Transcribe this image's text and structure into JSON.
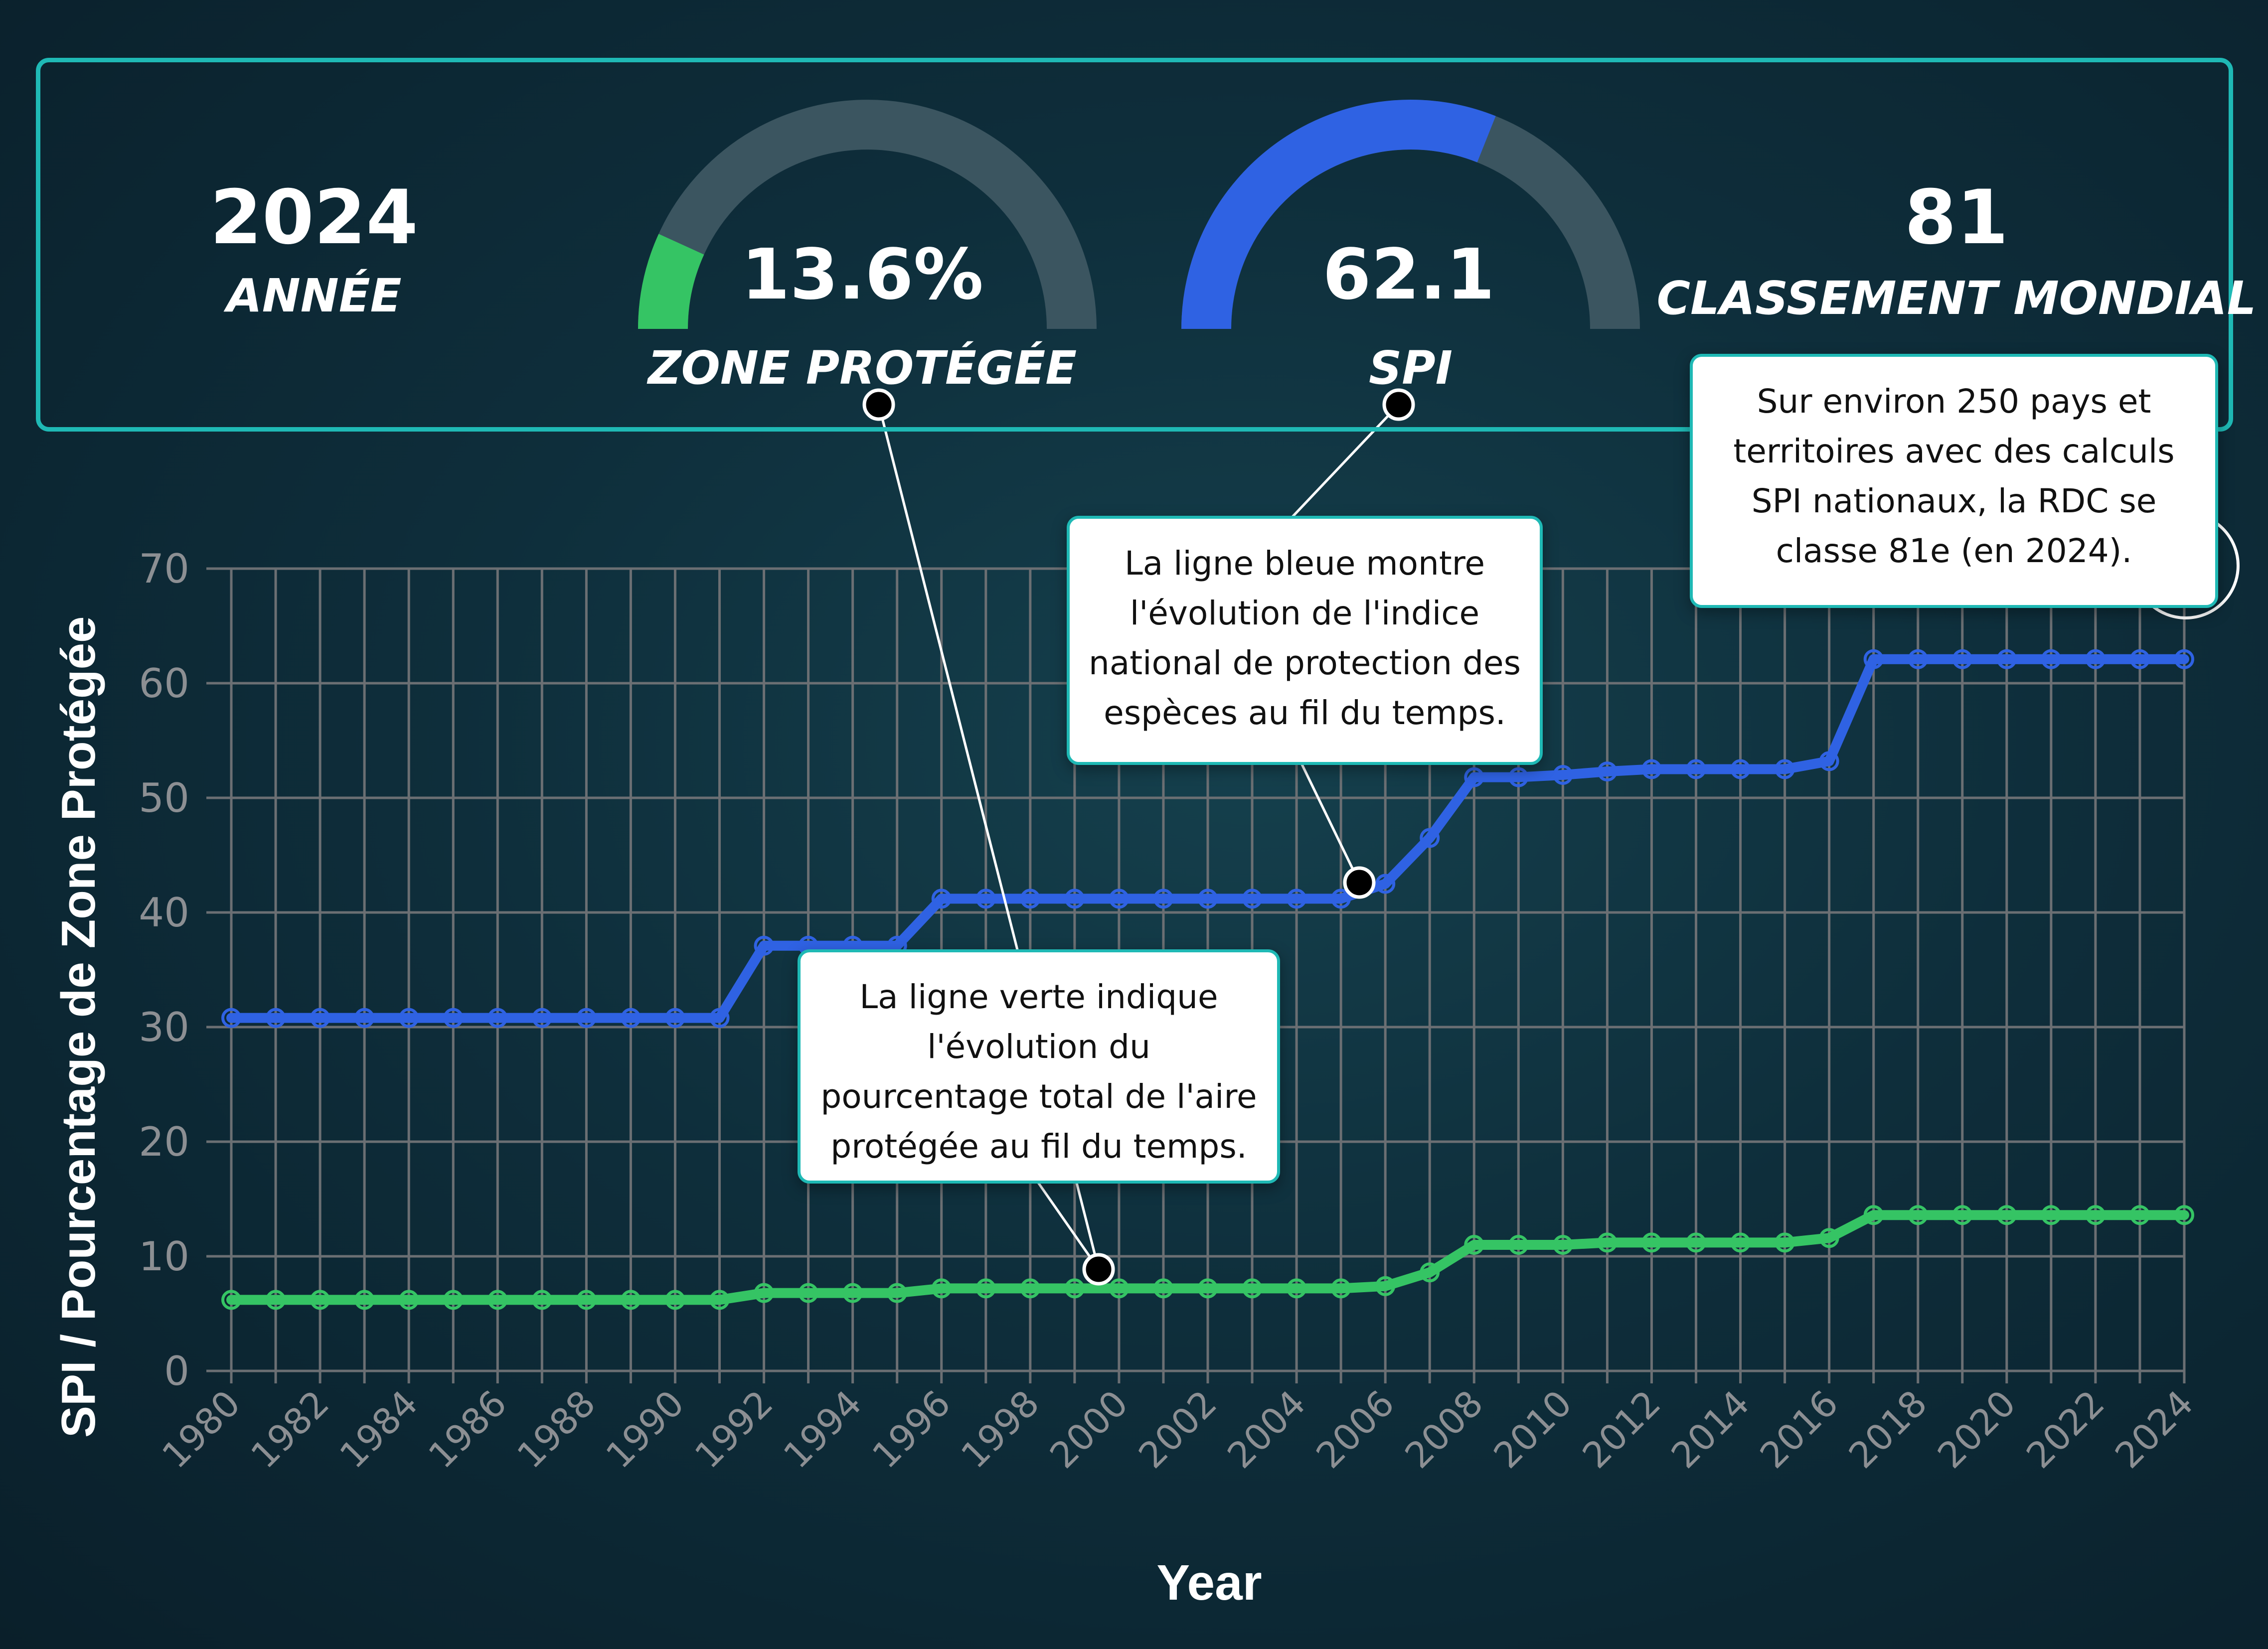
{
  "stats": {
    "year": {
      "value": "2024",
      "label": "ANNÉE"
    },
    "protected_area": {
      "value": "13.6%",
      "label": "ZONE PROTÉGÉE",
      "fraction": 0.136,
      "color": "#35c464"
    },
    "spi": {
      "value": "62.1",
      "label": "SPI",
      "fraction": 0.621,
      "color": "#2f62e3"
    },
    "rank": {
      "value": "81",
      "label": "CLASSEMENT MONDIAL"
    }
  },
  "colors": {
    "accent": "#1fb9b5",
    "gauge_track": "#3b5560",
    "spi_line": "#2f62e3",
    "area_line": "#35c464",
    "grid": "#6b6f73"
  },
  "callouts": {
    "green": "La ligne verte indique l'évolution du pourcentage total de l'aire protégée au fil du temps.",
    "blue": "La ligne bleue montre l'évolution de l'indice national de protection des espèces au fil du temps.",
    "rank": "Sur environ 250 pays et territoires avec des calculs SPI nationaux, la RDC se classe 81e (en 2024)."
  },
  "chart_data": {
    "type": "line",
    "xlabel": "Year",
    "ylabel": "SPI / Pourcentage de Zone Protégée",
    "ylim": [
      0,
      70
    ],
    "yticks": [
      0,
      10,
      20,
      30,
      40,
      50,
      60,
      70
    ],
    "x": [
      1980,
      1981,
      1982,
      1983,
      1984,
      1985,
      1986,
      1987,
      1988,
      1989,
      1990,
      1991,
      1992,
      1993,
      1994,
      1995,
      1996,
      1997,
      1998,
      1999,
      2000,
      2001,
      2002,
      2003,
      2004,
      2005,
      2006,
      2007,
      2008,
      2009,
      2010,
      2011,
      2012,
      2013,
      2014,
      2015,
      2016,
      2017,
      2018,
      2019,
      2020,
      2021,
      2022,
      2023,
      2024
    ],
    "xticks": [
      1980,
      1982,
      1984,
      1986,
      1988,
      1990,
      1992,
      1994,
      1996,
      1998,
      2000,
      2002,
      2004,
      2006,
      2008,
      2010,
      2012,
      2014,
      2016,
      2018,
      2020,
      2022,
      2024
    ],
    "grid": true,
    "series": [
      {
        "key": "spi",
        "color": "#2f62e3",
        "values": [
          30.8,
          30.8,
          30.8,
          30.8,
          30.8,
          30.8,
          30.8,
          30.8,
          30.8,
          30.8,
          30.8,
          30.8,
          37.1,
          37.1,
          37.1,
          37.1,
          41.2,
          41.2,
          41.2,
          41.2,
          41.2,
          41.2,
          41.2,
          41.2,
          41.2,
          41.2,
          42.5,
          46.5,
          51.8,
          51.8,
          52.0,
          52.3,
          52.5,
          52.5,
          52.5,
          52.5,
          53.2,
          62.1,
          62.1,
          62.1,
          62.1,
          62.1,
          62.1,
          62.1,
          62.1
        ]
      },
      {
        "key": "protected_area",
        "color": "#35c464",
        "values": [
          6.2,
          6.2,
          6.2,
          6.2,
          6.2,
          6.2,
          6.2,
          6.2,
          6.2,
          6.2,
          6.2,
          6.2,
          6.8,
          6.8,
          6.8,
          6.8,
          7.2,
          7.2,
          7.2,
          7.2,
          7.2,
          7.2,
          7.2,
          7.2,
          7.2,
          7.2,
          7.4,
          8.6,
          11.0,
          11.0,
          11.0,
          11.2,
          11.2,
          11.2,
          11.2,
          11.2,
          11.6,
          13.6,
          13.6,
          13.6,
          13.6,
          13.6,
          13.6,
          13.6,
          13.6
        ]
      }
    ]
  }
}
